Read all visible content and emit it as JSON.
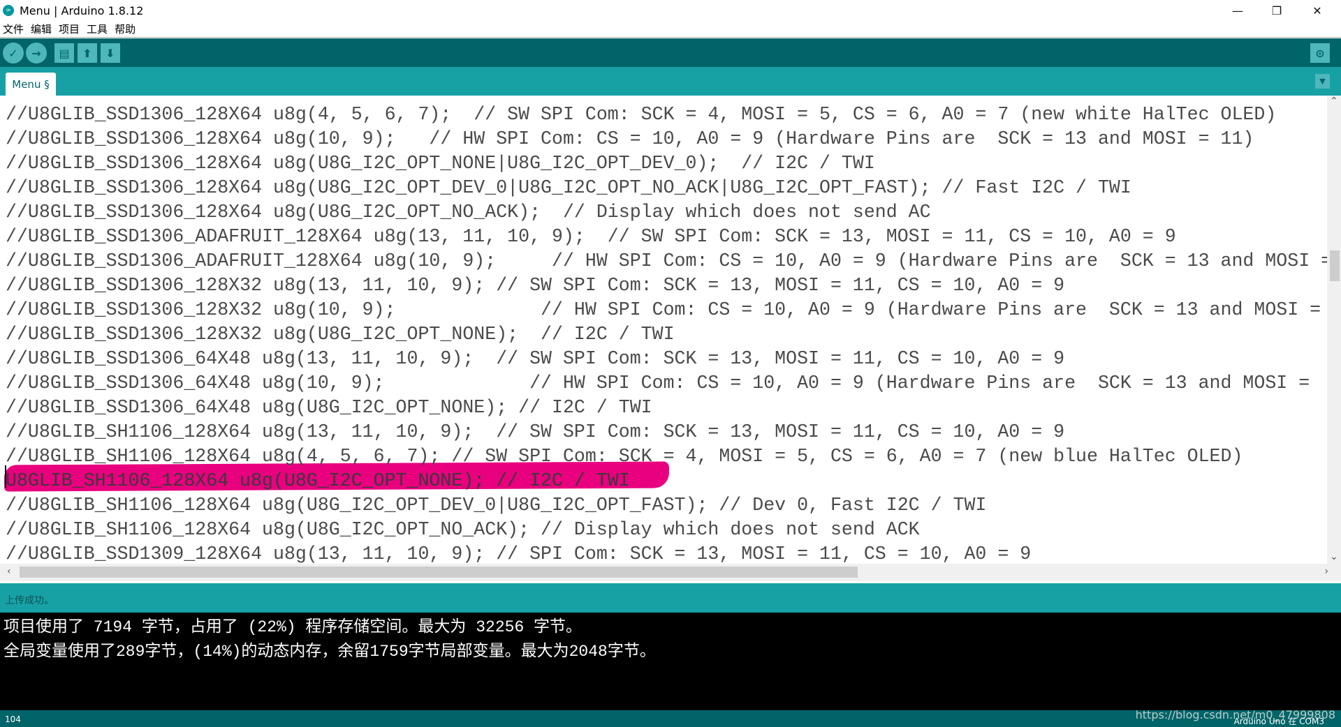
{
  "window": {
    "title": "Menu | Arduino 1.8.12",
    "minimize": "—",
    "restore": "❐",
    "close": "✕"
  },
  "menu": [
    "文件",
    "编辑",
    "项目",
    "工具",
    "帮助"
  ],
  "toolbar": {
    "verify": "✓",
    "upload": "→",
    "new": "▤",
    "open": "⬆",
    "save": "⬇",
    "serial_monitor": "⊙"
  },
  "tabs": [
    {
      "label": "Menu §"
    }
  ],
  "tab_menu": "▼",
  "code_lines": [
    "//U8GLIB_SSD1306_128X64 u8g(4, 5, 6, 7);  // SW SPI Com: SCK = 4, MOSI = 5, CS = 6, A0 = 7 (new white HalTec OLED)",
    "//U8GLIB_SSD1306_128X64 u8g(10, 9);   // HW SPI Com: CS = 10, A0 = 9 (Hardware Pins are  SCK = 13 and MOSI = 11)",
    "//U8GLIB_SSD1306_128X64 u8g(U8G_I2C_OPT_NONE|U8G_I2C_OPT_DEV_0);  // I2C / TWI",
    "//U8GLIB_SSD1306_128X64 u8g(U8G_I2C_OPT_DEV_0|U8G_I2C_OPT_NO_ACK|U8G_I2C_OPT_FAST); // Fast I2C / TWI",
    "//U8GLIB_SSD1306_128X64 u8g(U8G_I2C_OPT_NO_ACK);  // Display which does not send AC",
    "//U8GLIB_SSD1306_ADAFRUIT_128X64 u8g(13, 11, 10, 9);  // SW SPI Com: SCK = 13, MOSI = 11, CS = 10, A0 = 9",
    "//U8GLIB_SSD1306_ADAFRUIT_128X64 u8g(10, 9);     // HW SPI Com: CS = 10, A0 = 9 (Hardware Pins are  SCK = 13 and MOSI =",
    "//U8GLIB_SSD1306_128X32 u8g(13, 11, 10, 9); // SW SPI Com: SCK = 13, MOSI = 11, CS = 10, A0 = 9",
    "//U8GLIB_SSD1306_128X32 u8g(10, 9);             // HW SPI Com: CS = 10, A0 = 9 (Hardware Pins are  SCK = 13 and MOSI =",
    "//U8GLIB_SSD1306_128X32 u8g(U8G_I2C_OPT_NONE);  // I2C / TWI",
    "//U8GLIB_SSD1306_64X48 u8g(13, 11, 10, 9);  // SW SPI Com: SCK = 13, MOSI = 11, CS = 10, A0 = 9",
    "//U8GLIB_SSD1306_64X48 u8g(10, 9);             // HW SPI Com: CS = 10, A0 = 9 (Hardware Pins are  SCK = 13 and MOSI =",
    "//U8GLIB_SSD1306_64X48 u8g(U8G_I2C_OPT_NONE); // I2C / TWI",
    "//U8GLIB_SH1106_128X64 u8g(13, 11, 10, 9);  // SW SPI Com: SCK = 13, MOSI = 11, CS = 10, A0 = 9",
    "//U8GLIB_SH1106_128X64 u8g(4, 5, 6, 7); // SW SPI Com: SCK = 4, MOSI = 5, CS = 6, A0 = 7 (new blue HalTec OLED)",
    "U8GLIB_SH1106_128X64 u8g(U8G_I2C_OPT_NONE); // I2C / TWI",
    "//U8GLIB_SH1106_128X64 u8g(U8G_I2C_OPT_DEV_0|U8G_I2C_OPT_FAST); // Dev 0, Fast I2C / TWI",
    "//U8GLIB_SH1106_128X64 u8g(U8G_I2C_OPT_NO_ACK); // Display which does not send ACK",
    "//U8GLIB_SSD1309_128X64 u8g(13, 11, 10, 9); // SPI Com: SCK = 13, MOSI = 11, CS = 10, A0 = 9"
  ],
  "highlight_color": "#e8007f",
  "status": "上传成功。",
  "console_lines": [
    "项目使用了 7194 字节，占用了 (22%) 程序存储空间。最大为 32256 字节。",
    "全局变量使用了289字节，(14%)的动态内存，余留1759字节局部变量。最大为2048字节。"
  ],
  "bottom": {
    "line_number": "104",
    "board": "Arduino Uno 在 COM3",
    "watermark": "https://blog.csdn.net/m0_47999808"
  },
  "colors": {
    "toolbar": "#006468",
    "tabbar": "#17a1a5",
    "button": "#4db7bb"
  }
}
